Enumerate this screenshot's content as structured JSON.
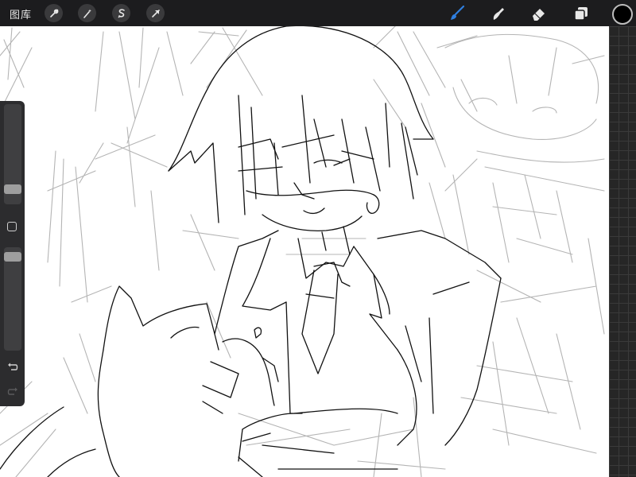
{
  "topbar": {
    "gallery_label": "图库",
    "left_tools": [
      "wrench-icon",
      "magic-wand-icon",
      "selection-icon",
      "transform-arrow-icon"
    ],
    "right_tools": [
      "brush-icon",
      "smudge-icon",
      "eraser-icon",
      "layers-icon"
    ],
    "active_tool": "brush-icon",
    "accent_color": "#2f7fe0",
    "current_color": "#000000"
  },
  "sidebar": {
    "brush_size_level": 0.78,
    "opacity_level": 0.07,
    "controls": [
      "modify-square-icon",
      "undo-icon",
      "redo-icon"
    ]
  },
  "canvas": {
    "background": "#ffffff",
    "content": "sketch"
  }
}
